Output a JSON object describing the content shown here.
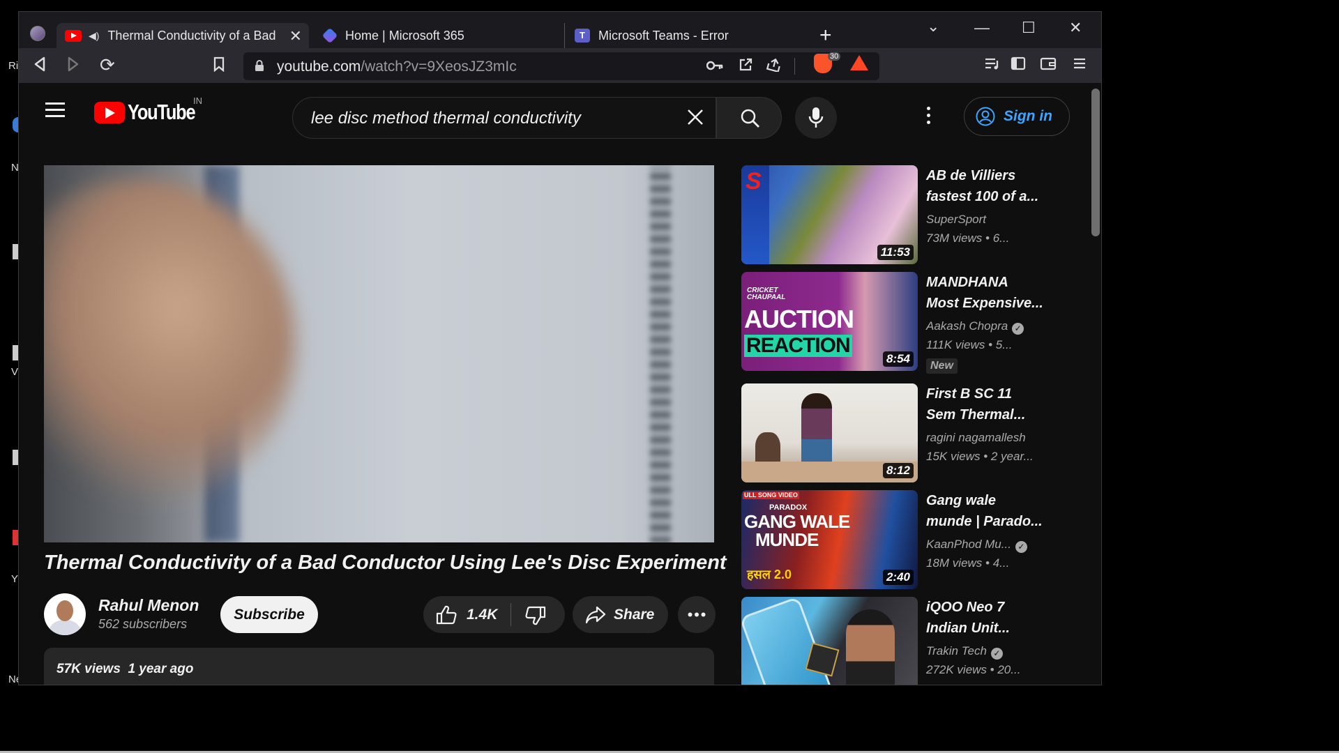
{
  "desktop": {
    "fragments": [
      "Ri",
      "N",
      "V",
      "Y",
      "New York"
    ]
  },
  "browser": {
    "tabs": [
      {
        "label": "Thermal Conductivity of a Bad",
        "active": true
      },
      {
        "label": "Home | Microsoft 365",
        "active": false
      },
      {
        "label": "Microsoft Teams - Error",
        "active": false
      }
    ],
    "url_host": "youtube.com",
    "url_path": "/watch?v=9XeosJZ3mIc",
    "brave_badge": "30"
  },
  "youtube": {
    "logo_text": "YouTube",
    "country_code": "IN",
    "search_query": "lee disc method thermal conductivity",
    "sign_in_label": "Sign in",
    "video": {
      "title": "Thermal Conductivity of a Bad Conductor Using Lee's Disc Experiment",
      "channel": "Rahul Menon",
      "subscribers": "562 subscribers",
      "subscribe_label": "Subscribe",
      "likes": "1.4K",
      "share_label": "Share",
      "views_and_age": "57K views  1 year ago"
    },
    "recommendations": [
      {
        "title_line1": "AB de Villiers",
        "title_line2": "fastest 100 of a...",
        "channel": "SuperSport",
        "meta": "73M views  • 6...",
        "duration": "11:53",
        "verified": false,
        "badge": ""
      },
      {
        "title_line1": "MANDHANA",
        "title_line2": "Most Expensive...",
        "channel": "Aakash Chopra",
        "meta": "111K views  • 5...",
        "duration": "8:54",
        "verified": true,
        "badge": "New"
      },
      {
        "title_line1": "First B SC 11",
        "title_line2": "Sem Thermal...",
        "channel": "ragini nagamallesh",
        "meta": "15K views  • 2 year...",
        "duration": "8:12",
        "verified": false,
        "badge": ""
      },
      {
        "title_line1": "Gang wale",
        "title_line2": "munde | Parado...",
        "channel": "KaanPhod Mu...",
        "meta": "18M views  • 4...",
        "duration": "2:40",
        "verified": true,
        "badge": ""
      },
      {
        "title_line1": "iQOO Neo 7",
        "title_line2": "Indian Unit...",
        "channel": "Trakin Tech",
        "meta": "272K views  • 20...",
        "duration": "",
        "verified": true,
        "badge": ""
      }
    ],
    "thumb_text": {
      "auction_top": "CRICKET CHAUPAAL",
      "auction_1": "AUCTION",
      "auction_2": "REACTION",
      "gang_small": "ULL SONG VIDEO",
      "gang_paradox": "PARADOX",
      "gang_1": "GANG WALE",
      "gang_2": "MUNDE",
      "gang_show": "हसल 2.0"
    }
  },
  "colors": {
    "accent_red": "#ff0000",
    "link_blue": "#3ea6ff"
  }
}
